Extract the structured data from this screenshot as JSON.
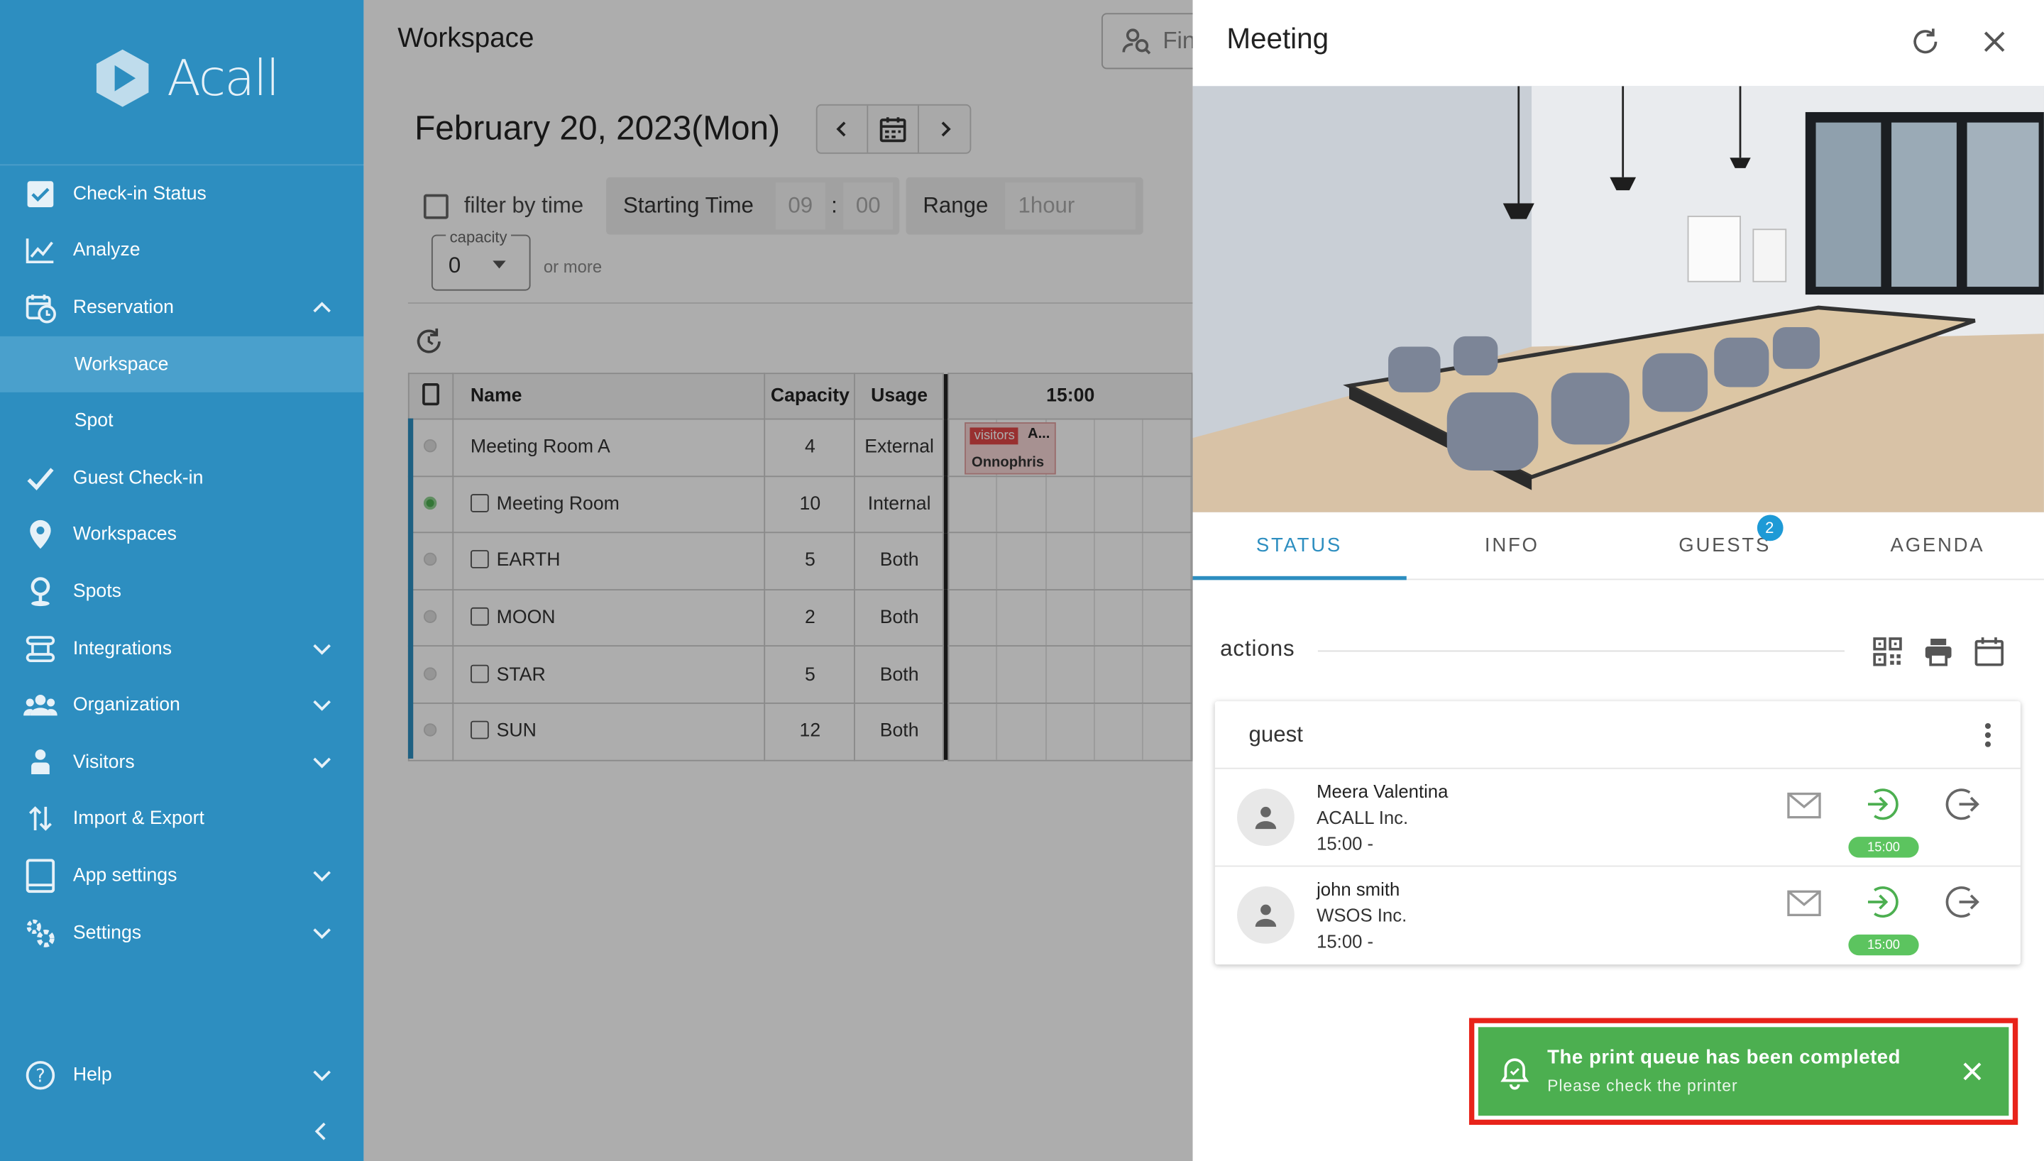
{
  "brand": {
    "name": "Acall"
  },
  "sidebar": {
    "items": [
      {
        "label": "Check-in Status",
        "icon": "check-square-icon"
      },
      {
        "label": "Analyze",
        "icon": "chart-icon"
      },
      {
        "label": "Reservation",
        "icon": "calendar-clock-icon"
      },
      {
        "label": "Workspace"
      },
      {
        "label": "Spot"
      },
      {
        "label": "Guest Check-in",
        "icon": "checkmark-icon"
      },
      {
        "label": "Workspaces",
        "icon": "map-pin-icon"
      },
      {
        "label": "Spots",
        "icon": "pin-icon"
      },
      {
        "label": "Integrations",
        "icon": "integrations-icon"
      },
      {
        "label": "Organization",
        "icon": "people-icon"
      },
      {
        "label": "Visitors",
        "icon": "visitor-icon"
      },
      {
        "label": "Import & Export",
        "icon": "import-export-icon"
      },
      {
        "label": "App settings",
        "icon": "tablet-icon"
      },
      {
        "label": "Settings",
        "icon": "gears-icon"
      }
    ],
    "help": "Help"
  },
  "main": {
    "title": "Workspace",
    "find_placeholder": "Fin",
    "date": "February 20, 2023(Mon)",
    "filter_label": "filter by time",
    "starting_time_label": "Starting Time",
    "hour": "09",
    "colon": ":",
    "minute": "00",
    "range_label": "Range",
    "range_value": "1hour",
    "capacity_label": "capacity",
    "capacity_value": "0",
    "or_more": "or more",
    "table": {
      "headers": [
        "Name",
        "Capacity",
        "Usage",
        "15:00"
      ],
      "rows": [
        {
          "name": "Meeting Room A",
          "capacity": "4",
          "usage": "External"
        },
        {
          "name": "Meeting Room",
          "capacity": "10",
          "usage": "Internal"
        },
        {
          "name": "EARTH",
          "capacity": "5",
          "usage": "Both"
        },
        {
          "name": "MOON",
          "capacity": "2",
          "usage": "Both"
        },
        {
          "name": "STAR",
          "capacity": "5",
          "usage": "Both"
        },
        {
          "name": "SUN",
          "capacity": "12",
          "usage": "Both"
        }
      ],
      "booking": {
        "tag": "visitors",
        "title": "A...",
        "organizer": "Onnophris"
      }
    }
  },
  "panel": {
    "title": "Meeting",
    "tabs": [
      "STATUS",
      "INFO",
      "GUESTS",
      "AGENDA"
    ],
    "guests_badge": "2",
    "actions_label": "actions",
    "card_title": "guest",
    "guests": [
      {
        "name": "Meera Valentina",
        "org": "ACALL Inc.",
        "time": "15:00  -",
        "checkin_time": "15:00"
      },
      {
        "name": "john smith",
        "org": "WSOS Inc.",
        "time": "15:00  -",
        "checkin_time": "15:00"
      }
    ]
  },
  "toast": {
    "title": "The print queue has been completed",
    "subtitle": "Please check the printer"
  },
  "colors": {
    "sidebar": "#2d8ec0",
    "accent": "#2d8ec0",
    "toast": "#4caf50",
    "highlight": "#e8231a"
  }
}
